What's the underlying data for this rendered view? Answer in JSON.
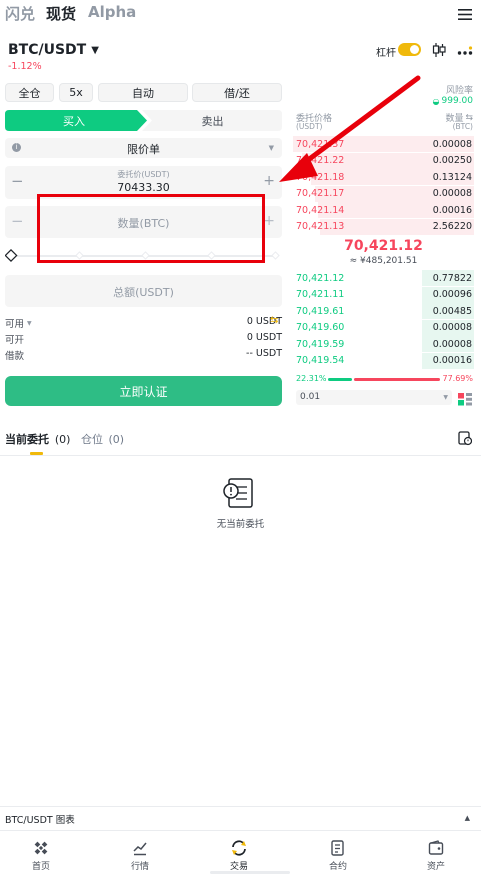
{
  "top_tabs": [
    "闪兑",
    "现货",
    "Alpha"
  ],
  "pair": {
    "symbol": "BTC/USDT",
    "change": "-1.12%"
  },
  "leverage_label": "杠杆",
  "margin_buttons": [
    "全仓",
    "5x",
    "自动",
    "借/还"
  ],
  "side_tabs": {
    "buy": "买入",
    "sell": "卖出"
  },
  "order_type": "限价单",
  "price_field": {
    "label": "委托价(USDT)",
    "value": "70433.30"
  },
  "amount_field": {
    "placeholder": "数量(BTC)"
  },
  "total_field": {
    "placeholder": "总额(USDT)"
  },
  "balances": [
    {
      "label": "可用",
      "value": "0 USDT"
    },
    {
      "label": "可开",
      "value": "0 USDT"
    },
    {
      "label": "借款",
      "value": "-- USDT"
    }
  ],
  "submit_label": "立即认证",
  "orderbook": {
    "risk_label": "风险率",
    "risk_value": "999.00",
    "price_header": "委托价格",
    "price_unit": "(USDT)",
    "qty_header": "数量",
    "qty_unit": "(BTC)",
    "asks": [
      {
        "price": "70,421.37",
        "qty": "0.00008",
        "depth": 1.0
      },
      {
        "price": "70,421.22",
        "qty": "0.00250",
        "depth": 0.95
      },
      {
        "price": "70,421.18",
        "qty": "0.13124",
        "depth": 0.9
      },
      {
        "price": "70,421.17",
        "qty": "0.00008",
        "depth": 0.88
      },
      {
        "price": "70,421.14",
        "qty": "0.00016",
        "depth": 0.86
      },
      {
        "price": "70,421.13",
        "qty": "2.56220",
        "depth": 0.85
      }
    ],
    "mid_price": "70,421.12",
    "mid_cny": "≈ ¥485,201.51",
    "bids": [
      {
        "price": "70,421.12",
        "qty": "0.77822",
        "depth": 0.29
      },
      {
        "price": "70,421.11",
        "qty": "0.00096",
        "depth": 0.29
      },
      {
        "price": "70,419.61",
        "qty": "0.00485",
        "depth": 0.29
      },
      {
        "price": "70,419.60",
        "qty": "0.00008",
        "depth": 0.29
      },
      {
        "price": "70,419.59",
        "qty": "0.00008",
        "depth": 0.29
      },
      {
        "price": "70,419.54",
        "qty": "0.00016",
        "depth": 0.29
      }
    ],
    "buy_ratio": "22.31%",
    "sell_ratio": "77.69%",
    "buy_ratio_value": 22.31,
    "precision": "0.01"
  },
  "orders_tabs": {
    "open": "当前委托",
    "open_count": "(0)",
    "positions": "仓位",
    "positions_count": "(0)"
  },
  "empty_text": "无当前委托",
  "chart_bar_label": "BTC/USDT 图表",
  "bottom_nav": [
    "首页",
    "行情",
    "交易",
    "合约",
    "资产"
  ],
  "colors": {
    "buy": "#0ecb81",
    "sell": "#f6465d",
    "accent": "#f0b90b",
    "annotation": "#e8000b"
  }
}
